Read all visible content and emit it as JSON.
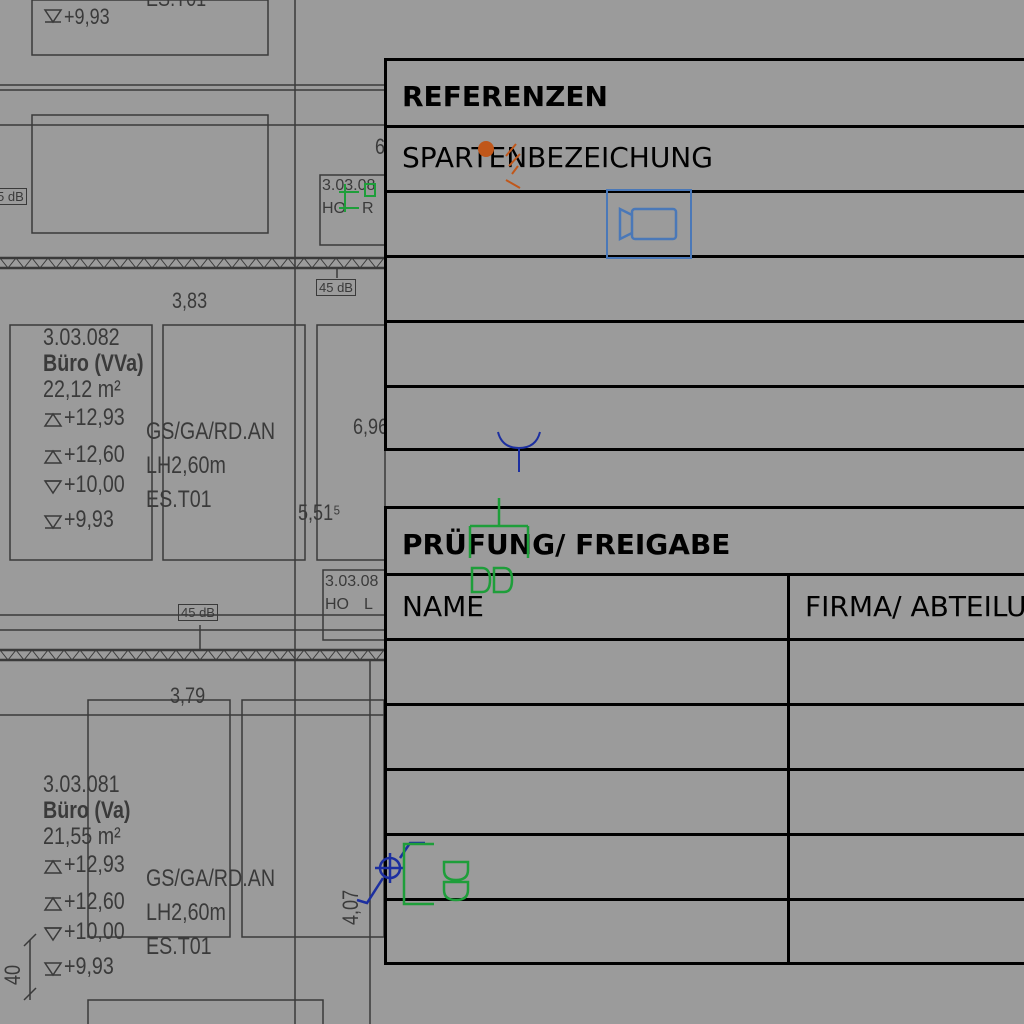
{
  "plan": {
    "rooms": [
      {
        "number": "3.03.082",
        "name": "Büro (VVa)",
        "area": "22,12 m²",
        "lv1": "+12,93",
        "lv2": "+12,60",
        "lv3": "+10,00",
        "lv4": "+9,93"
      },
      {
        "number": "3.03.081",
        "name": "Büro (Va)",
        "area": "21,55 m²",
        "lv1": "+12,93",
        "lv2": "+12,60",
        "lv3": "+10,00",
        "lv4": "+9,93"
      }
    ],
    "top_level": "+9,93",
    "top_partial": "ES.T01",
    "specs": [
      "GS/GA/RD.AN",
      "LH2,60m",
      "ES.T01"
    ],
    "dims": {
      "d383": "3,83",
      "d379": "3,79",
      "d696": "6,96",
      "d551": "5,51⁵",
      "d407": "4,07",
      "d40": "40",
      "d6": "6"
    },
    "db_tags": [
      "5 dB",
      "45 dB",
      "45 dB"
    ],
    "door_tags": [
      {
        "code": "3.03.08",
        "a": "HO",
        "b": "R"
      },
      {
        "code": "3.03.08",
        "a": "HO",
        "b": "L"
      }
    ]
  },
  "referenzen": {
    "title": "REFERENZEN",
    "row1": "SPARTENBEZEICHUNG",
    "rows": [
      "",
      "",
      "",
      ""
    ]
  },
  "pruefung": {
    "title": "PRÜFUNG/ FREIGABE",
    "col1": "NAME",
    "col2": "FIRMA/ ABTEILUNG",
    "rows": [
      "",
      "",
      "",
      "",
      ""
    ]
  },
  "colors": {
    "background": "#9b9b9b",
    "plan_line": "#3a3a3a",
    "panel_border": "#000000",
    "camera_icon": "#4a78b8",
    "markup_green": "#1e9e3a",
    "markup_orange": "#c0571a",
    "markup_blue": "#1c2fa0"
  },
  "icons": [
    "camera-icon",
    "cursor-crosshair-icon",
    "edit-marker-icon",
    "receiver-symbol-icon",
    "outlet-symbol-icon"
  ]
}
